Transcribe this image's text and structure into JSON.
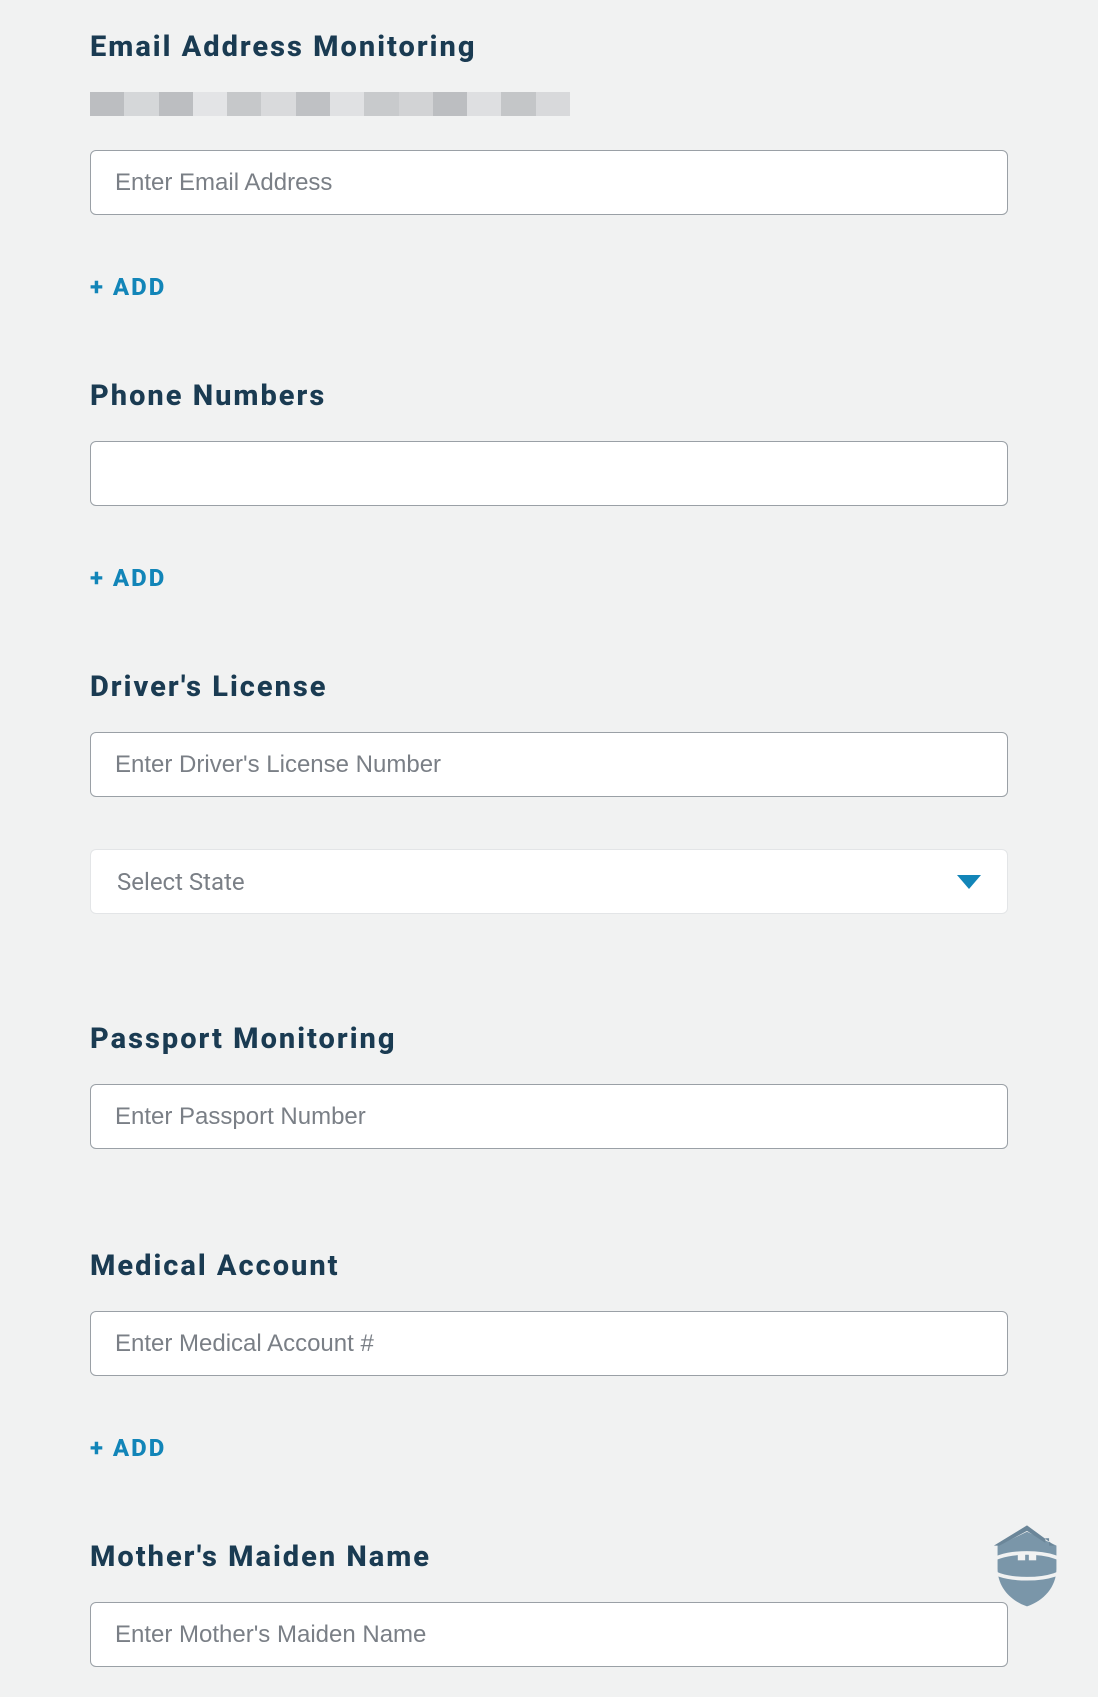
{
  "sections": {
    "email": {
      "heading": "Email Address Monitoring",
      "placeholder": "Enter Email Address",
      "add_label": "+ ADD"
    },
    "phone": {
      "heading": "Phone Numbers",
      "placeholder": "",
      "add_label": "+ ADD"
    },
    "drivers_license": {
      "heading": "Driver's License",
      "placeholder": "Enter Driver's License Number",
      "select_placeholder": "Select State"
    },
    "passport": {
      "heading": "Passport Monitoring",
      "placeholder": "Enter Passport Number"
    },
    "medical": {
      "heading": "Medical Account",
      "placeholder": "Enter Medical Account #",
      "add_label": "+ ADD"
    },
    "maiden": {
      "heading": "Mother's Maiden Name",
      "placeholder": "Enter Mother's Maiden Name"
    }
  },
  "colors": {
    "heading": "#1a3b52",
    "accent": "#1285b8",
    "placeholder": "#7a7f86",
    "background": "#f1f2f2"
  }
}
